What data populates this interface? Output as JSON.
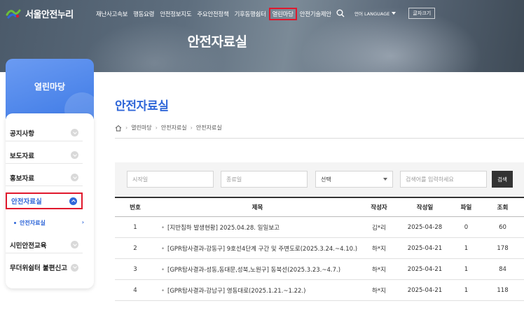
{
  "header": {
    "logo_text": "서울안전누리",
    "nav": [
      "재난사고속보",
      "행동요령",
      "안전정보지도",
      "주요안전정책",
      "기후동행쉼터",
      "열린마당",
      "안전기술제안"
    ],
    "active_nav": "열린마당",
    "language_label": "언어 LANGUAGE",
    "font_size_label": "글자크기",
    "hero_title": "안전자료실"
  },
  "sidebar": {
    "title": "열린마당",
    "items": [
      {
        "label": "공지사항"
      },
      {
        "label": "보도자료"
      },
      {
        "label": "홍보자료"
      },
      {
        "label": "안전자료실"
      },
      {
        "label": "시민안전교육"
      },
      {
        "label": "무더위쉼터 불편신고"
      }
    ],
    "active_item": "안전자료실",
    "sub_item": "안전자료실",
    "sub_chevron": "›"
  },
  "main": {
    "title": "안전자료실",
    "breadcrumb": [
      "열린마당",
      "안전자료실",
      "안전자료실"
    ],
    "filter": {
      "start_placeholder": "시작일",
      "end_placeholder": "종료일",
      "select_value": "선택",
      "keyword_placeholder": "검색어를 입력하세요",
      "search_button": "검색"
    },
    "table": {
      "headers": [
        "번호",
        "제목",
        "작성자",
        "작성일",
        "파일",
        "조회"
      ],
      "rows": [
        {
          "no": "1",
          "title": "[지반침하 발생현황] 2025.04.28. 일일보고",
          "author": "김*리",
          "date": "2025-04-28",
          "file": "0",
          "views": "60"
        },
        {
          "no": "2",
          "title": "[GPR탐사결과-강동구] 9호선4단계 구간 및 주변도로(2025.3.24.~4.10.)",
          "author": "하*지",
          "date": "2025-04-21",
          "file": "1",
          "views": "178"
        },
        {
          "no": "3",
          "title": "[GPR탐사결과-성동,동대문,성북,노원구] 동북선(2025.3.23.~4.7.)",
          "author": "하*지",
          "date": "2025-04-21",
          "file": "1",
          "views": "84"
        },
        {
          "no": "4",
          "title": "[GPR탐사결과-강남구] 영동대로(2025.1.21.~1.22.)",
          "author": "하*지",
          "date": "2025-04-21",
          "file": "1",
          "views": "118"
        }
      ]
    }
  },
  "colors": {
    "accent": "#2f66d8",
    "highlight": "#e0182d",
    "sidebar_head": "#4a85ec"
  }
}
